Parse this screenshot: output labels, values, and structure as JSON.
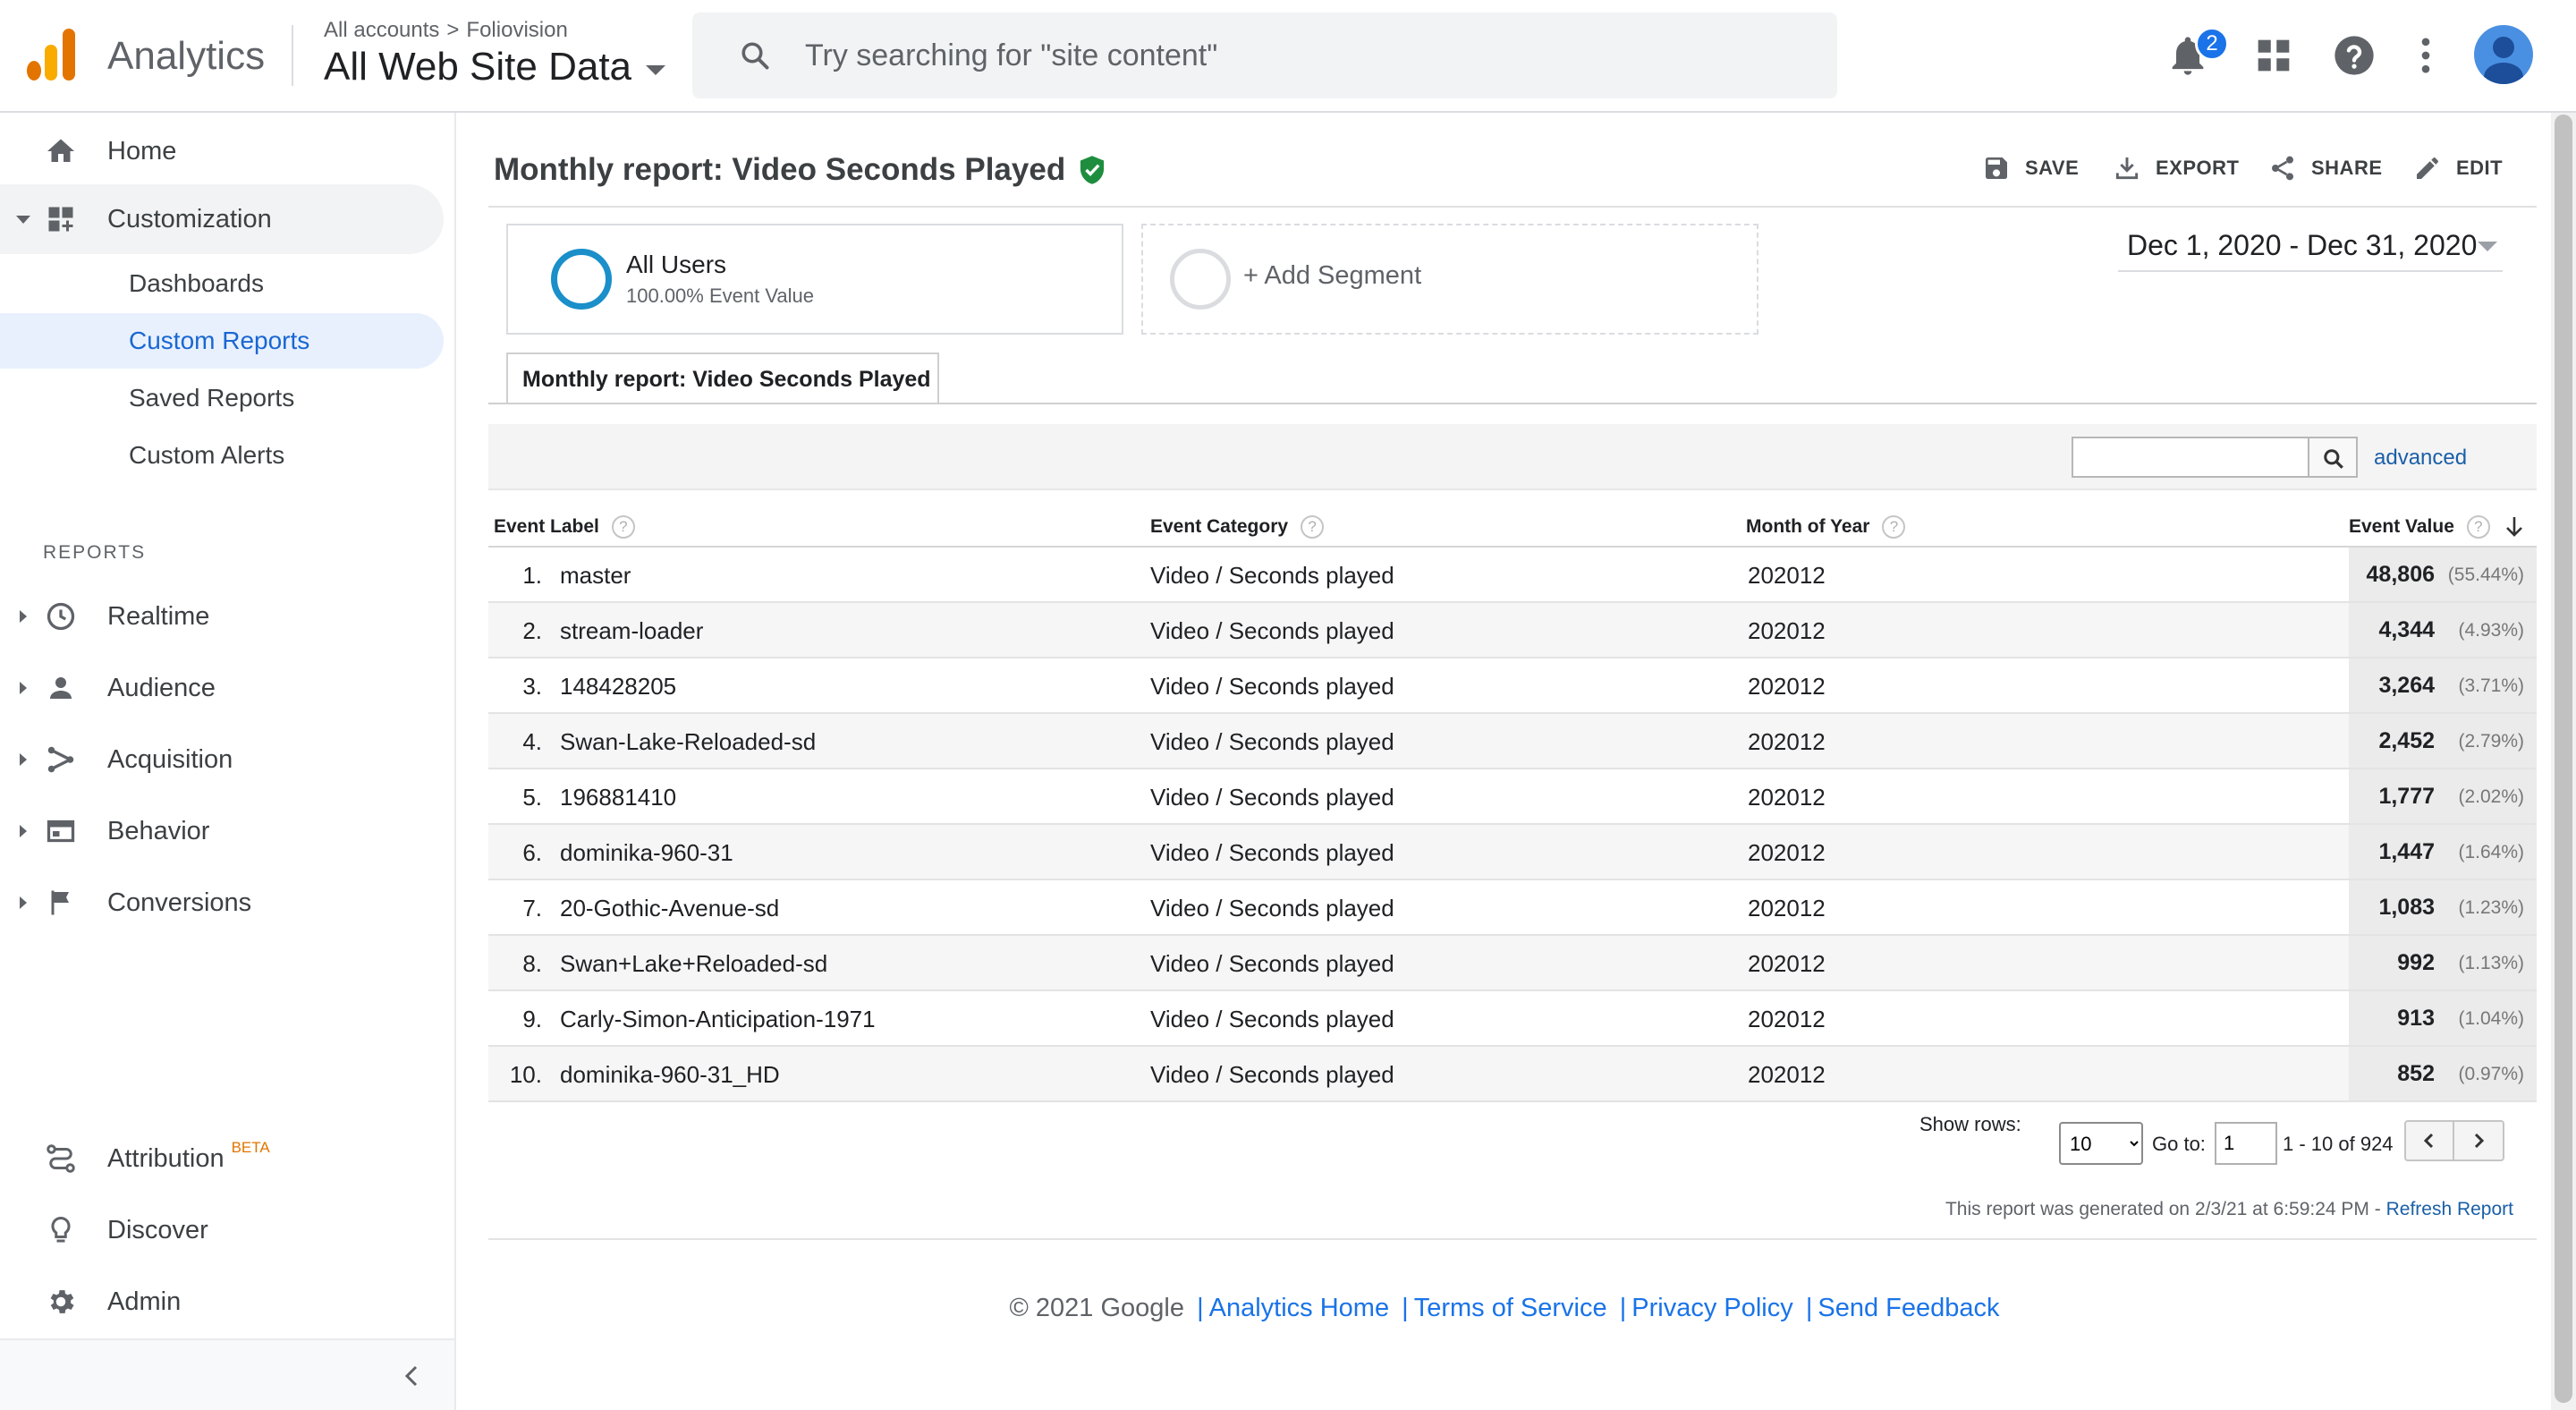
{
  "header": {
    "brand": "Analytics",
    "breadcrumb": {
      "account": "All accounts",
      "separator": ">",
      "property": "Foliovision"
    },
    "view": "All Web Site Data",
    "search_placeholder": "Try searching for \"site content\"",
    "notification_count": "2",
    "icons": [
      "search-icon",
      "bell-icon",
      "apps-grid-icon",
      "help-icon",
      "more-vert-icon",
      "account-avatar"
    ]
  },
  "sidebar": {
    "home": "Home",
    "customization": "Customization",
    "custom_sub": [
      "Dashboards",
      "Custom Reports",
      "Saved Reports",
      "Custom Alerts"
    ],
    "reports_heading": "REPORTS",
    "reports": [
      "Realtime",
      "Audience",
      "Acquisition",
      "Behavior",
      "Conversions"
    ],
    "attribution": "Attribution",
    "beta": "BETA",
    "discover": "Discover",
    "admin": "Admin"
  },
  "report": {
    "title": "Monthly report: Video Seconds Played",
    "actions": {
      "save": "SAVE",
      "export": "EXPORT",
      "share": "SHARE",
      "edit": "EDIT"
    },
    "segment": {
      "name": "All Users",
      "sub": "100.00% Event Value"
    },
    "add_segment": "+ Add Segment",
    "date_range": "Dec 1, 2020 - Dec 31, 2020",
    "tab": "Monthly report: Video Seconds Played",
    "advanced": "advanced",
    "help_glyph": "?",
    "columns": [
      "Event Label",
      "Event Category",
      "Month of Year",
      "Event Value"
    ],
    "rows": [
      {
        "n": "1.",
        "label": "master",
        "category": "Video / Seconds played",
        "month": "202012",
        "value": "48,806",
        "pct": "(55.44%)"
      },
      {
        "n": "2.",
        "label": "stream-loader",
        "category": "Video / Seconds played",
        "month": "202012",
        "value": "4,344",
        "pct": "(4.93%)"
      },
      {
        "n": "3.",
        "label": "148428205",
        "category": "Video / Seconds played",
        "month": "202012",
        "value": "3,264",
        "pct": "(3.71%)"
      },
      {
        "n": "4.",
        "label": "Swan-Lake-Reloaded-sd",
        "category": "Video / Seconds played",
        "month": "202012",
        "value": "2,452",
        "pct": "(2.79%)"
      },
      {
        "n": "5.",
        "label": "196881410",
        "category": "Video / Seconds played",
        "month": "202012",
        "value": "1,777",
        "pct": "(2.02%)"
      },
      {
        "n": "6.",
        "label": "dominika-960-31",
        "category": "Video / Seconds played",
        "month": "202012",
        "value": "1,447",
        "pct": "(1.64%)"
      },
      {
        "n": "7.",
        "label": "20-Gothic-Avenue-sd",
        "category": "Video / Seconds played",
        "month": "202012",
        "value": "1,083",
        "pct": "(1.23%)"
      },
      {
        "n": "8.",
        "label": "Swan+Lake+Reloaded-sd",
        "category": "Video / Seconds played",
        "month": "202012",
        "value": "992",
        "pct": "(1.13%)"
      },
      {
        "n": "9.",
        "label": "Carly-Simon-Anticipation-1971",
        "category": "Video / Seconds played",
        "month": "202012",
        "value": "913",
        "pct": "(1.04%)"
      },
      {
        "n": "10.",
        "label": "dominika-960-31_HD",
        "category": "Video / Seconds played",
        "month": "202012",
        "value": "852",
        "pct": "(0.97%)"
      }
    ],
    "pagination": {
      "show_rows_label": "Show rows:",
      "show_rows_value": "10",
      "goto_label": "Go to:",
      "goto_value": "1",
      "range": "1 - 10 of 924"
    },
    "generated": "This report was generated on 2/3/21 at 6:59:24 PM -",
    "refresh": "Refresh Report"
  },
  "footer": {
    "copyright": "© 2021 Google",
    "links": [
      "Analytics Home",
      "Terms of Service",
      "Privacy Policy",
      "Send Feedback"
    ],
    "separator": "|"
  },
  "colors": {
    "accent": "#1a73e8",
    "ring": "#1a8fc9",
    "logo_orange": "#e37400",
    "logo_yellow": "#f9ab00"
  }
}
